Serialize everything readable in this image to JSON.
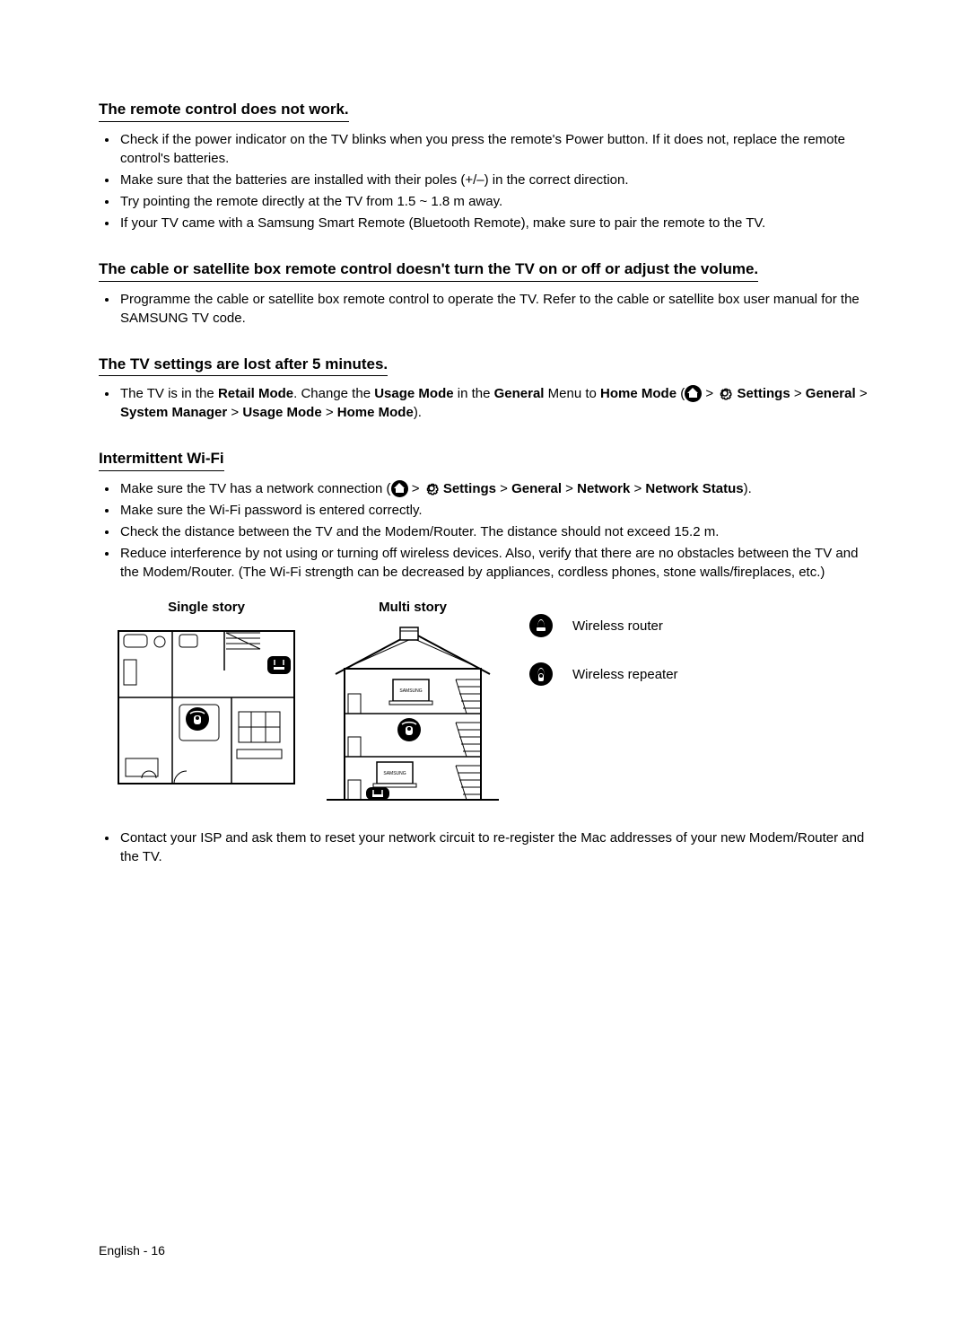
{
  "sections": [
    {
      "heading": "The remote control does not work.",
      "items": [
        {
          "text": "Check if the power indicator on the TV blinks when you press the remote's Power button. If it does not, replace the remote control's batteries."
        },
        {
          "text": "Make sure that the batteries are installed with their poles (+/–) in the correct direction."
        },
        {
          "text": "Try pointing the remote directly at the TV from 1.5 ~ 1.8 m away."
        },
        {
          "text": "If your TV came with a Samsung Smart Remote (Bluetooth Remote), make sure to pair the remote to the TV."
        }
      ]
    },
    {
      "heading": "The cable or satellite box remote control doesn't turn the TV on or off or adjust the volume.",
      "items": [
        {
          "text": "Programme the cable or satellite box remote control to operate the TV. Refer to the cable or satellite box user manual for the SAMSUNG TV code."
        }
      ]
    },
    {
      "heading": "The TV settings are lost after 5 minutes.",
      "items": [
        {
          "special": "retail_mode"
        }
      ]
    },
    {
      "heading": "Intermittent Wi-Fi",
      "items": [
        {
          "special": "network_connection"
        },
        {
          "text": "Make sure the Wi-Fi password is entered correctly."
        },
        {
          "text": "Check the distance between the TV and the Modem/Router. The distance should not exceed 15.2 m."
        },
        {
          "text": "Reduce interference by not using or turning off wireless devices. Also, verify that there are no obstacles between the TV and the Modem/Router. (The Wi-Fi strength can be decreased by appliances, cordless phones, stone walls/fireplaces, etc.)"
        }
      ]
    }
  ],
  "retail": {
    "pre": "The TV is in the ",
    "retail_mode": "Retail Mode",
    "mid1": ". Change the ",
    "usage_mode": "Usage Mode",
    "mid2": " in the ",
    "general": "General",
    "mid3": " Menu to ",
    "home_mode": "Home Mode",
    "open_paren": " (",
    "gt": " > ",
    "settings": "Settings",
    "system_manager": "System Manager",
    "close": ")."
  },
  "network": {
    "pre": "Make sure the TV has a network connection (",
    "gt": " > ",
    "settings": "Settings",
    "general": "General",
    "networkw": "Network",
    "network_status": "Network Status",
    "close": ")."
  },
  "diagrams": {
    "single": "Single story",
    "multi": "Multi story"
  },
  "legend": {
    "router": "Wireless router",
    "repeater": "Wireless repeater"
  },
  "closing_bullet": "Contact your ISP and ask them to reset your network circuit to re-register the Mac addresses of your new Modem/Router and the TV.",
  "footer": "English - 16"
}
